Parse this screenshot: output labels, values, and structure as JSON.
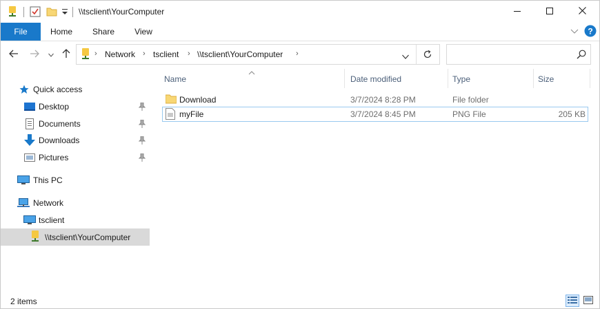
{
  "window": {
    "title": "\\\\tsclient\\YourComputer",
    "controls": {
      "minimize": "minimize-icon",
      "maximize": "maximize-icon",
      "close": "close-icon"
    }
  },
  "ribbon": {
    "tabs": [
      "File",
      "Home",
      "Share",
      "View"
    ]
  },
  "nav": {
    "breadcrumbs": [
      "Network",
      "tsclient",
      "\\\\tsclient\\YourComputer"
    ],
    "search_placeholder": ""
  },
  "sidebar": {
    "items": [
      {
        "label": "Quick access",
        "icon": "star-icon"
      },
      {
        "label": "Desktop",
        "icon": "desktop-folder-icon",
        "pinned": true
      },
      {
        "label": "Documents",
        "icon": "documents-icon",
        "pinned": true
      },
      {
        "label": "Downloads",
        "icon": "download-arrow-icon",
        "pinned": true
      },
      {
        "label": "Pictures",
        "icon": "pictures-icon",
        "pinned": true
      },
      {
        "label": "This PC",
        "icon": "monitor-icon"
      },
      {
        "label": "Network",
        "icon": "network-icon"
      },
      {
        "label": "tsclient",
        "icon": "monitor-icon"
      },
      {
        "label": "\\\\tsclient\\YourComputer",
        "icon": "network-drive-icon",
        "selected": true
      }
    ]
  },
  "columns": [
    "Name",
    "Date modified",
    "Type",
    "Size"
  ],
  "files": [
    {
      "name": "Download",
      "date": "3/7/2024 8:28 PM",
      "type": "File folder",
      "size": ""
    },
    {
      "name": "myFile",
      "date": "3/7/2024 8:45 PM",
      "type": "PNG File",
      "size": "205 KB"
    }
  ],
  "status": {
    "item_count": "2 items"
  },
  "colors": {
    "accent": "#1979ca",
    "folder": "#f8d775",
    "selection": "#d9d9d9",
    "header_text": "#4c607a"
  }
}
